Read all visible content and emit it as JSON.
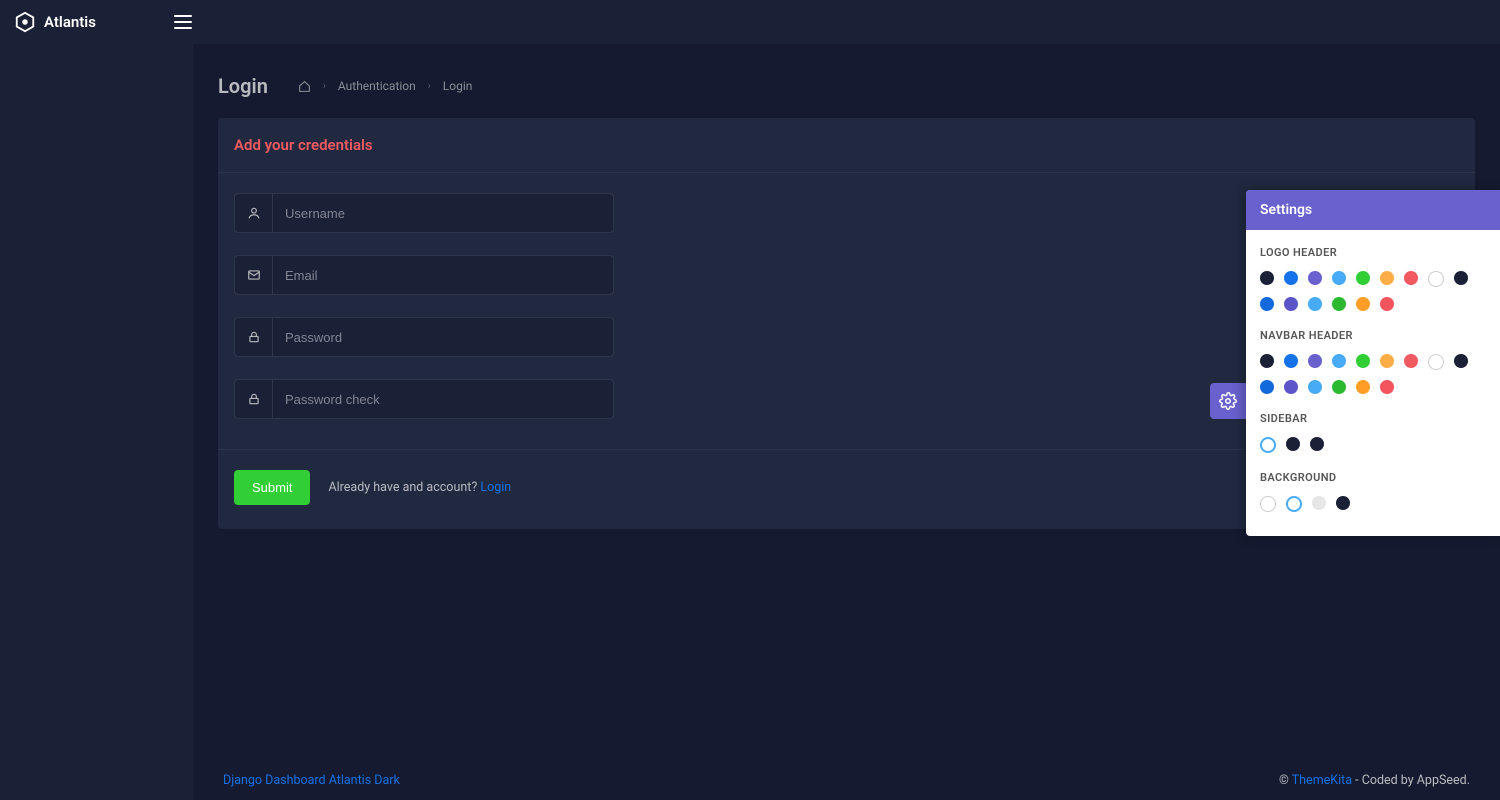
{
  "brand": {
    "name": "Atlantis"
  },
  "page": {
    "title": "Login"
  },
  "breadcrumb": {
    "item_auth": "Authentication",
    "item_login": "Login"
  },
  "card": {
    "title": "Add your credentials"
  },
  "fields": {
    "username_placeholder": "Username",
    "email_placeholder": "Email",
    "password_placeholder": "Password",
    "password2_placeholder": "Password check"
  },
  "actions": {
    "submit_label": "Submit",
    "already_text": "Already have and account? ",
    "login_link": "Login"
  },
  "footer": {
    "left_link": "Django Dashboard Atlantis Dark",
    "copyright_prefix": "© ",
    "theme_link": "ThemeKita",
    "copyright_suffix": " - Coded by AppSeed."
  },
  "settings": {
    "title": "Settings",
    "logo_header_label": "LOGO HEADER",
    "navbar_header_label": "NAVBAR HEADER",
    "sidebar_label": "SIDEBAR",
    "background_label": "BACKGROUND",
    "logo_colors": [
      "#1a2035",
      "#1572e8",
      "#6861ce",
      "#48abf7",
      "#31ce36",
      "#ffad46",
      "#f25961",
      "#ffffff",
      "#1a2035",
      "#1269db",
      "#5c55ca",
      "#48abf7",
      "#2bb930",
      "#ff9e27",
      "#f3545d"
    ],
    "navbar_colors": [
      "#1a2035",
      "#1572e8",
      "#6861ce",
      "#48abf7",
      "#31ce36",
      "#ffad46",
      "#f25961",
      "#ffffff",
      "#1a2035",
      "#1269db",
      "#5c55ca",
      "#48abf7",
      "#2bb930",
      "#ff9e27",
      "#f3545d"
    ],
    "sidebar_colors": [
      "hollow",
      "#1a2035",
      "#1a2035"
    ],
    "background_colors": [
      "white-b",
      "hollow",
      "grey-b",
      "#1a2035"
    ]
  }
}
